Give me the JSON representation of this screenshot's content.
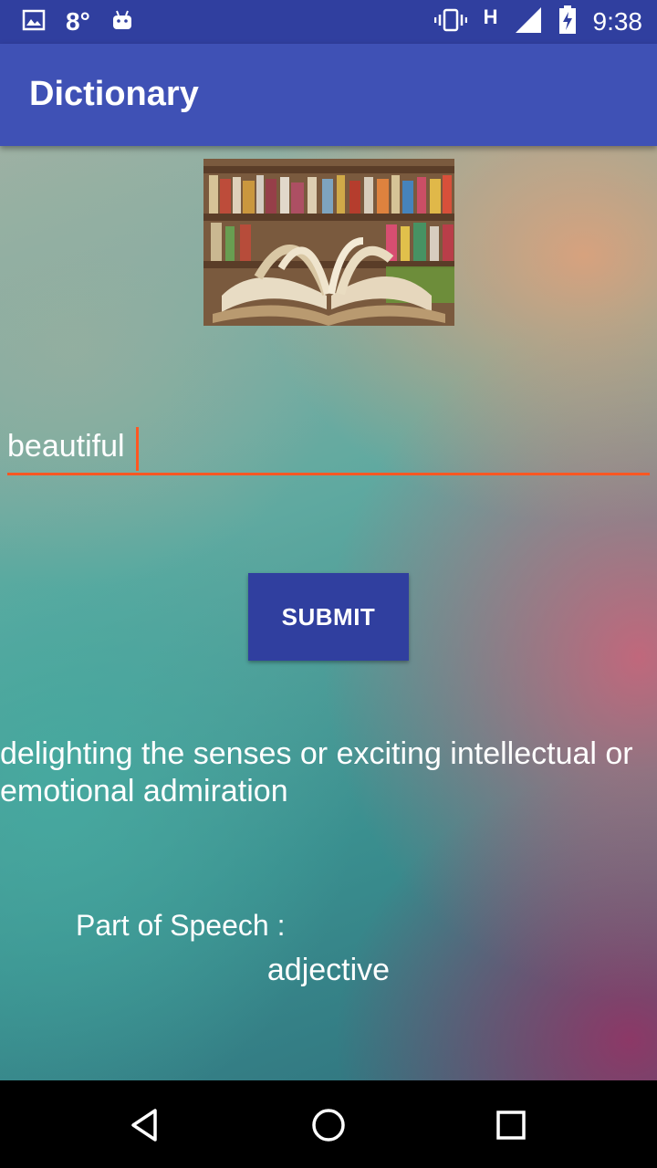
{
  "status_bar": {
    "temperature": "8°",
    "network_type": "H",
    "time": "9:38",
    "icons": [
      "image-icon",
      "android-icon",
      "vibrate-icon",
      "signal-icon",
      "battery-icon"
    ]
  },
  "app_bar": {
    "title": "Dictionary"
  },
  "header_image": {
    "icon": "open-book-image"
  },
  "search": {
    "value": "beautiful",
    "accent": "#ff5722"
  },
  "submit": {
    "label": "SUBMIT"
  },
  "result": {
    "definition": "delighting the senses or exciting intellectual or emotional admiration",
    "part_of_speech_label": "Part of Speech :",
    "part_of_speech_value": "adjective"
  },
  "nav_bar": {
    "buttons": [
      "back-icon",
      "home-icon",
      "recents-icon"
    ]
  },
  "colors": {
    "primary": "#3f51b5",
    "primary_dark": "#303f9f",
    "accent": "#ff5722"
  }
}
